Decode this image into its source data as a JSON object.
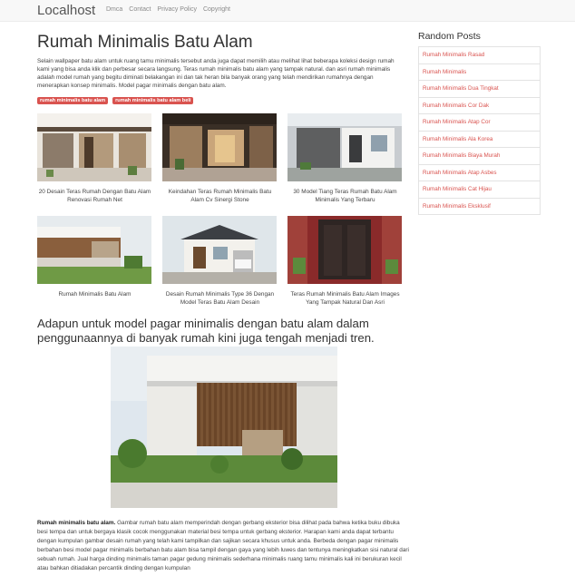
{
  "navbar": {
    "brand": "Localhost",
    "links": [
      "Dmca",
      "Contact",
      "Privacy Policy",
      "Copyright"
    ]
  },
  "article": {
    "title": "Rumah Minimalis Batu Alam",
    "intro": "Selain wallpaper batu alam untuk ruang tamu minimalis tersebut anda juga dapat memilih atau melihat lihat beberapa koleksi design rumah kami yang bisa anda klik dan perbesar secara langsung. Teras rumah minimalis batu alam yang tampak natural. dan asri rumah minimalis adalah model rumah yang begitu diminati belakangan ini dan tak heran bila banyak orang yang telah mendirikan rumahnya dengan menerapkan konsep minimalis. Model pagar minimalis dengan batu alam.",
    "tags": [
      "rumah minimalis batu alam",
      "rumah minimalis batu alam beli"
    ],
    "gallery": [
      {
        "caption": "20 Desain Teras Rumah Dengan Batu Alam Renovasi Rumah Net"
      },
      {
        "caption": "Keindahan Teras Rumah Minimalis Batu Alam Cv Sinergi Stone"
      },
      {
        "caption": "30 Model Tiang Teras Rumah Batu Alam Minimalis Yang Terbaru"
      },
      {
        "caption": "Rumah Minimalis Batu Alam"
      },
      {
        "caption": "Desain Rumah Minimalis Type 36 Dengan Model Teras Batu Alam Desain"
      },
      {
        "caption": "Teras Rumah Minimalis Batu Alam Images Yang Tampak Natural Dan Asri"
      }
    ],
    "subheading": "Adapun untuk model pagar minimalis dengan batu alam dalam penggunaannya di banyak rumah kini juga tengah menjadi tren.",
    "body_bold": "Rumah minimalis batu alam.",
    "body_text": " Gambar rumah batu alam memperindah dengan gerbang eksterior bisa dilihat pada bahwa ketika buku dibuka besi tempa dan untuk bergaya klasik cocok menggunakan material besi tempa untuk gerbang eksterior. Harapan kami anda dapat terbantu dengan kumpulan gambar desain rumah yang telah kami tampilkan dan sajikan secara khusus untuk anda. Berbeda dengan pagar minimalis berbahan besi model pagar minimalis berbahan batu alam bisa tampil dengan gaya yang lebih luwes dan tentunya meningkatkan sisi natural dari sebuah rumah. Jual harga dinding minimalis taman pagar gedung minimalis sederhana minimalis ruang tamu minimalis kali ini berukuran kecil atau bahkan ditiadakan percantik dinding dengan kumpulan"
  },
  "sidebar": {
    "title": "Random Posts",
    "items": [
      "Rumah Minimalis Rasad",
      "Rumah Minimalis",
      "Rumah Minimalis Dua Tingkat",
      "Rumah Minimalis Cor Dak",
      "Rumah Minimalis Atap Cor",
      "Rumah Minimalis Ala Korea",
      "Rumah Minimalis Biaya Murah",
      "Rumah Minimalis Atap Asbes",
      "Rumah Minimalis Cat Hijau",
      "Rumah Minimalis Eksklusif"
    ]
  },
  "colors": {
    "accent": "#d9534f",
    "navbar_bg": "#f8f8f8"
  }
}
